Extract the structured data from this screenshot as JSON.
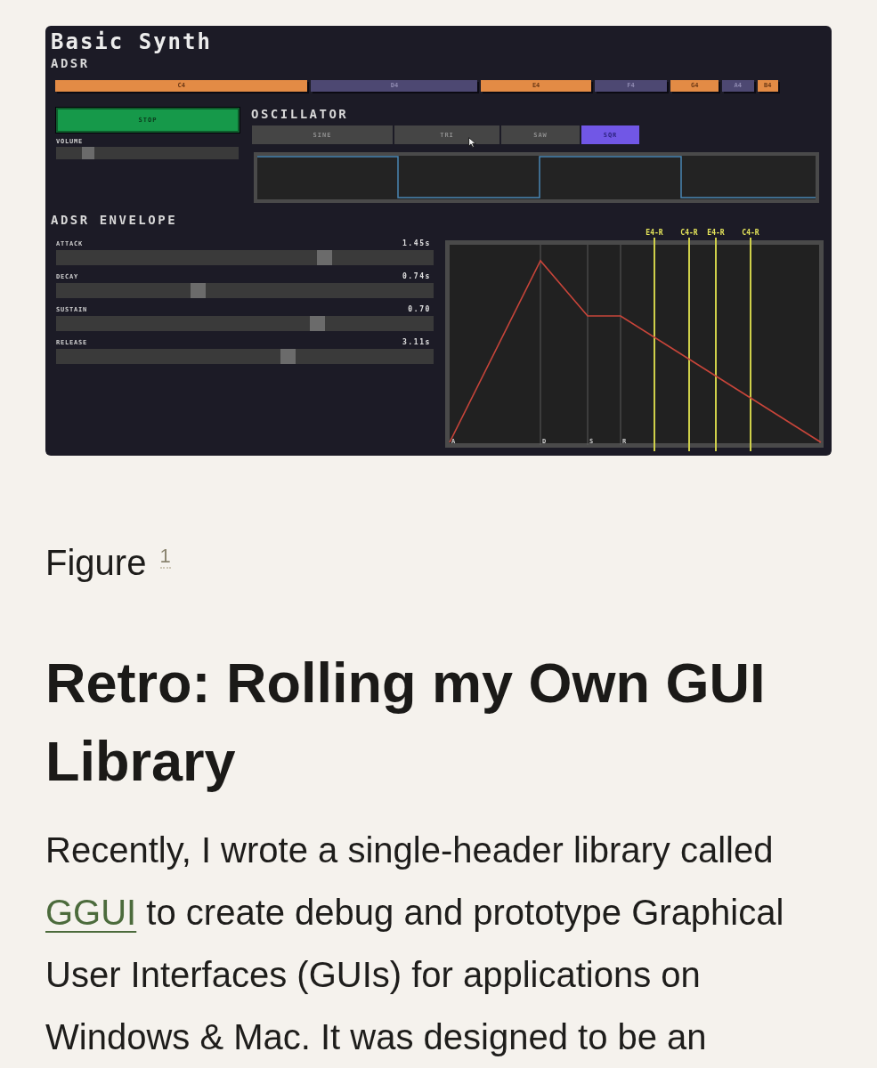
{
  "synth": {
    "title": "Basic Synth",
    "notes_heading": "ADSR",
    "notes": [
      {
        "label": "C4",
        "color": "#e38b45"
      },
      {
        "label": "D4",
        "color": "#4d4872"
      },
      {
        "label": "E4",
        "color": "#e38b45"
      },
      {
        "label": "F4",
        "color": "#4d4872"
      },
      {
        "label": "G4",
        "color": "#e38b45"
      },
      {
        "label": "A4",
        "color": "#4d4872"
      },
      {
        "label": "B4",
        "color": "#e38b45"
      }
    ],
    "play_button": "STOP",
    "volume": {
      "label": "VOLUME",
      "level": 0.15
    },
    "oscillator": {
      "heading": "OSCILLATOR",
      "waveforms": [
        {
          "label": "SINE",
          "selected": false
        },
        {
          "label": "TRI",
          "selected": false
        },
        {
          "label": "SAW",
          "selected": false
        },
        {
          "label": "SQR",
          "selected": true
        }
      ]
    },
    "envelope": {
      "heading": "ADSR ENVELOPE",
      "parameters": [
        {
          "label": "ATTACK",
          "reading": "1.45s",
          "level": 0.72
        },
        {
          "label": "DECAY",
          "reading": "0.74s",
          "level": 0.37
        },
        {
          "label": "SUSTAIN",
          "reading": "0.70",
          "level": 0.7
        },
        {
          "label": "RELEASE",
          "reading": "3.11s",
          "level": 0.62
        }
      ],
      "stage_labels": [
        "A",
        "D",
        "S",
        "R"
      ],
      "release_markers": [
        "E4-R",
        "C4-R",
        "E4-R",
        "C4-R"
      ]
    }
  },
  "figure": {
    "caption": "Figure",
    "footnote": "1"
  },
  "article": {
    "title": "Retro: Rolling my Own GUI Library",
    "paragraph": {
      "before_link": "Recently, I wrote a single-header library called",
      "link": "GGUI",
      "after_link": "to create debug and prototype Graphical User Interfaces (GUIs) for applications on Windows & Mac. It was designed to be an"
    }
  }
}
